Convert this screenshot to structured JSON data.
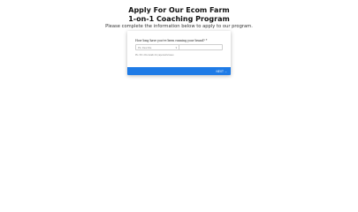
{
  "header": {
    "title_line1": "Apply For Our Ecom Farm",
    "title_line2": "1-on-1 Coaching Program",
    "subtitle": "Please complete the information below to apply to our program."
  },
  "form": {
    "question": "How long have you've been running your brand? *",
    "select_value": "Pls. Describe",
    "helper_text": "Pls. fill in this details for paperwork/cases",
    "next_label": "NEXT →"
  },
  "colors": {
    "accent": "#1f7be6"
  }
}
